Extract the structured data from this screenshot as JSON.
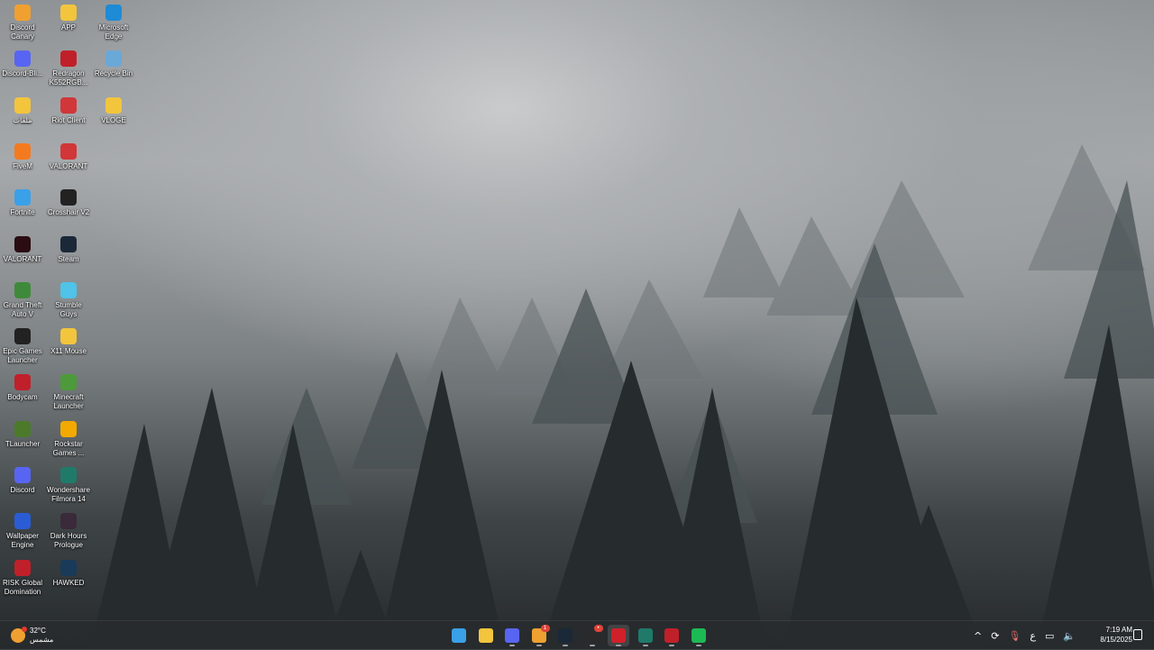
{
  "desktop": {
    "icons": [
      {
        "label": "Discord Canary",
        "icon": "discord-canary-icon",
        "color": "#f0a030"
      },
      {
        "label": "APP",
        "icon": "folder-icon",
        "color": "#f2c53d"
      },
      {
        "label": "Microsoft Edge",
        "icon": "edge-icon",
        "color": "#1f8ad6"
      },
      {
        "label": "Discord-Bli...",
        "icon": "discord-icon",
        "color": "#5865f2"
      },
      {
        "label": "Redragon K552RGB...",
        "icon": "redragon-icon",
        "color": "#c0202a"
      },
      {
        "label": "Recycle Bin",
        "icon": "recycle-bin-icon",
        "color": "#6aa8d8"
      },
      {
        "label": "ملفات",
        "icon": "folder-icon",
        "color": "#f2c53d"
      },
      {
        "label": "Riot Client",
        "icon": "riot-client-icon",
        "color": "#d13639"
      },
      {
        "label": "VLOGE",
        "icon": "folder-icon",
        "color": "#f2c53d"
      },
      {
        "label": "FiveM",
        "icon": "fivem-icon",
        "color": "#f47a20"
      },
      {
        "label": "VALORANT",
        "icon": "valorant-riot-icon",
        "color": "#d13639"
      },
      {
        "label": "Fortnite",
        "icon": "fortnite-icon",
        "color": "#3aa0e8"
      },
      {
        "label": "Crosshair V2",
        "icon": "crosshair-icon",
        "color": "#222222"
      },
      {
        "label": "VALORANT",
        "icon": "valorant-icon",
        "color": "#2a0d12"
      },
      {
        "label": "Steam",
        "icon": "steam-icon",
        "color": "#1b2838"
      },
      {
        "label": "Grand Theft Auto V",
        "icon": "gta-icon",
        "color": "#3f8a3a"
      },
      {
        "label": "Stumble Guys",
        "icon": "stumble-guys-icon",
        "color": "#4fc3e8"
      },
      {
        "label": "Epic Games Launcher",
        "icon": "epic-games-icon",
        "color": "#222222"
      },
      {
        "label": "X11 Mouse",
        "icon": "mouse-icon",
        "color": "#f2c53d"
      },
      {
        "label": "Bodycam",
        "icon": "bodycam-icon",
        "color": "#c0202a"
      },
      {
        "label": "Minecraft Launcher",
        "icon": "minecraft-icon",
        "color": "#4c9a3a"
      },
      {
        "label": "TLauncher",
        "icon": "tlauncher-icon",
        "color": "#4c7a2a"
      },
      {
        "label": "Rockstar Games ...",
        "icon": "rockstar-icon",
        "color": "#f2a900"
      },
      {
        "label": "Discord",
        "icon": "discord-icon",
        "color": "#5865f2"
      },
      {
        "label": "Wondershare Filmora 14",
        "icon": "filmora-icon",
        "color": "#1f7a6a"
      },
      {
        "label": "Wallpaper Engine",
        "icon": "wallpaper-engine-icon",
        "color": "#2a5cd6"
      },
      {
        "label": "Dark Hours Prologue",
        "icon": "dark-hours-icon",
        "color": "#3a2a3a"
      },
      {
        "label": "RISK Global Domination",
        "icon": "risk-icon",
        "color": "#c0202a"
      },
      {
        "label": "HAWKED",
        "icon": "hawked-icon",
        "color": "#1a3a5a"
      }
    ]
  },
  "taskbar": {
    "weather": {
      "temp": "32°C",
      "condition": "مشمس"
    },
    "apps": [
      {
        "name": "start",
        "icon": "windows-start-icon",
        "color": "#3aa0e8",
        "active": false,
        "running": false,
        "badge": ""
      },
      {
        "name": "file-explorer",
        "icon": "folder-icon",
        "color": "#f2c53d",
        "active": false,
        "running": false,
        "badge": ""
      },
      {
        "name": "discord",
        "icon": "discord-icon",
        "color": "#5865f2",
        "active": false,
        "running": true,
        "badge": ""
      },
      {
        "name": "discord-canary",
        "icon": "discord-canary-icon",
        "color": "#f0a030",
        "active": false,
        "running": true,
        "badge": "1"
      },
      {
        "name": "steam",
        "icon": "steam-icon",
        "color": "#1b2838",
        "active": false,
        "running": true,
        "badge": ""
      },
      {
        "name": "obs",
        "icon": "obs-icon",
        "color": "#2a2a2a",
        "active": false,
        "running": true,
        "badge": "•"
      },
      {
        "name": "opera",
        "icon": "opera-icon",
        "color": "#d0202a",
        "active": true,
        "running": true,
        "badge": ""
      },
      {
        "name": "filmora",
        "icon": "filmora-icon",
        "color": "#1f7a6a",
        "active": false,
        "running": true,
        "badge": ""
      },
      {
        "name": "cheat-app",
        "icon": "red-app-icon",
        "color": "#c0202a",
        "active": false,
        "running": true,
        "badge": ""
      },
      {
        "name": "spotify",
        "icon": "spotify-icon",
        "color": "#1db954",
        "active": false,
        "running": true,
        "badge": ""
      }
    ],
    "tray": {
      "chevron": "^",
      "keyboard_lang": "ع"
    },
    "clock": {
      "time": "7:19 AM",
      "date": "8/15/2025"
    }
  }
}
